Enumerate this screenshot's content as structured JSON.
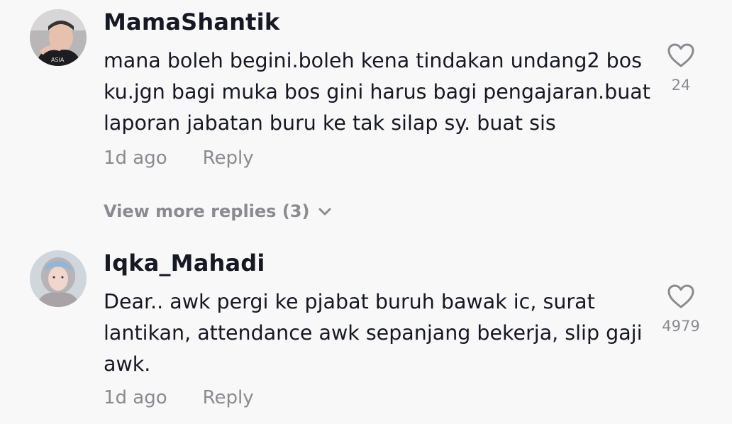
{
  "comments": [
    {
      "username": "MamaShantik",
      "text_lines": [
        "mana boleh begini.boleh kena tindakan undang2 bos",
        "ku.jgn bagi muka bos gini harus bagi pengajaran.buat",
        "laporan jabatan buru ke tak silap sy. buat sis"
      ],
      "time": "1d ago",
      "reply_label": "Reply",
      "like_count": "24",
      "like_icon": "heart-outline-icon",
      "view_more": "View more replies (3)"
    },
    {
      "username": "Iqka_Mahadi",
      "text_lines": [
        "Dear.. awk pergi ke pjabat buruh bawak ic, surat",
        "lantikan, attendance awk sepanjang bekerja, slip gaji",
        "awk."
      ],
      "time": "1d ago",
      "reply_label": "Reply",
      "like_count": "4979",
      "like_icon": "heart-outline-icon"
    }
  ],
  "colors": {
    "background": "#f8f8f8",
    "primary_text": "#161823",
    "secondary_text": "#8a8b91"
  }
}
